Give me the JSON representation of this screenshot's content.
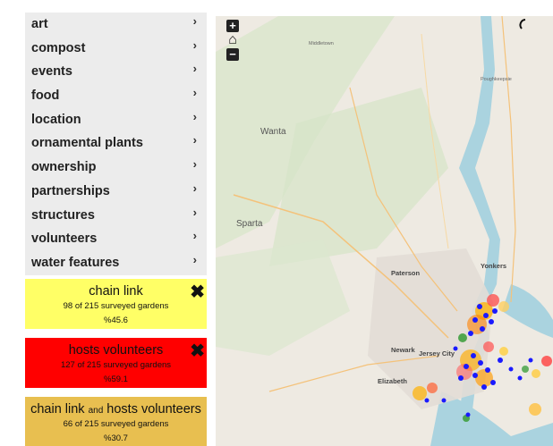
{
  "sidebar": {
    "categories": [
      "art",
      "compost",
      "events",
      "food",
      "location",
      "ornamental plants",
      "ownership",
      "partnerships",
      "structures",
      "volunteers",
      "water features"
    ],
    "chevron": "›"
  },
  "cards": [
    {
      "title": "chain link",
      "count": "98 of 215 surveyed gardens",
      "percent": "%45.6",
      "color": "#ffff66",
      "close": "✖"
    },
    {
      "title": "hosts volunteers",
      "count": "127 of 215 surveyed gardens",
      "percent": "%59.1",
      "color": "#ff0000",
      "close": "✖"
    },
    {
      "title_a": "chain link",
      "title_and": "and",
      "title_b": "hosts volunteers",
      "count": "66 of 215 surveyed gardens",
      "percent": "%30.7",
      "color": "#e8bf50"
    }
  ],
  "map": {
    "controls": {
      "zoom_in": "+",
      "home": "⌂",
      "zoom_out": "−"
    },
    "labels": [
      "Wanta",
      "Sparta",
      "Paterson",
      "Yonkers",
      "Newark",
      "Jersey City",
      "Elizabeth",
      "Middletown",
      "Poughkeepsie"
    ]
  }
}
